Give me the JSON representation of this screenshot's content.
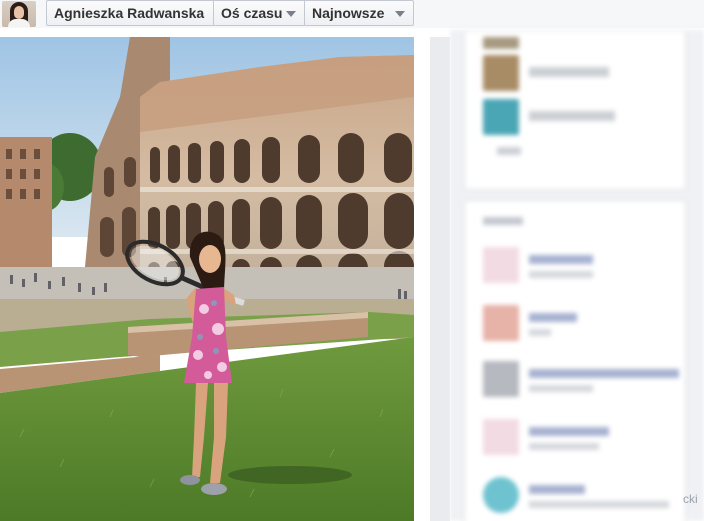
{
  "header": {
    "profile_name": "Agnieszka Radwanska",
    "timeline_label": "Oś czasu",
    "sort_label": "Najnowsze"
  },
  "icons": {
    "avatar": "profile-photo",
    "timeline_dropdown": "chevron-down-icon",
    "sort_dropdown": "chevron-down-icon"
  },
  "colors": {
    "topbar_bg": "#f6f7f9",
    "button_border": "#c4c8d0",
    "sidebar_bg": "#e9ebee"
  },
  "footer": {
    "fragment": "cki"
  }
}
